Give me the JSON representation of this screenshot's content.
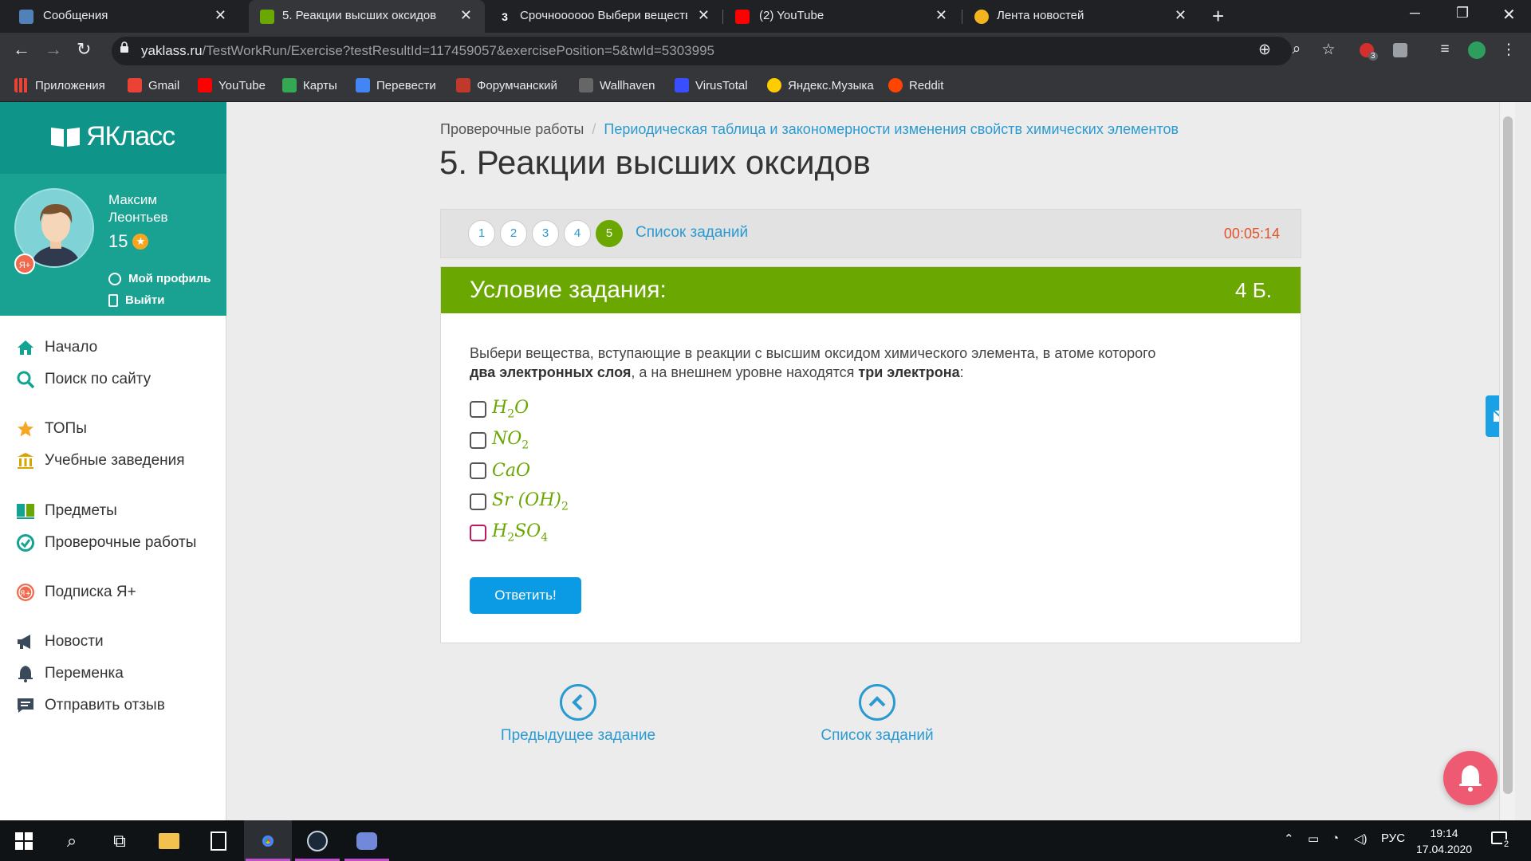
{
  "browser": {
    "tabs": [
      {
        "title": "Сообщения",
        "color": "#5181b8"
      },
      {
        "title": "5. Реакции высших оксидов",
        "color": "#6aa700"
      },
      {
        "title": "Срочноооооо Выбери вещества",
        "color": "#202124"
      },
      {
        "title": "(2) YouTube",
        "color": "#ff0000"
      },
      {
        "title": "Лента новостей",
        "color": "#f2b51d"
      }
    ],
    "url_domain": "yaklass.ru",
    "url_path": "/TestWorkRun/Exercise?testResultId=117459057&exercisePosition=5&twId=5303995",
    "extension_badge": "3",
    "bookmarks": [
      "Приложения",
      "Gmail",
      "YouTube",
      "Карты",
      "Перевести",
      "Форумчанский",
      "Wallhaven",
      "VirusTotal",
      "Яндекс.Музыка",
      "Reddit"
    ]
  },
  "sidebar": {
    "logo": "ЯКласс",
    "user": {
      "first_name": "Максим",
      "last_name": "Леонтьев",
      "points": "15"
    },
    "profile_link": "Мой профиль",
    "logout_link": "Выйти",
    "menu": [
      {
        "label": "Начало",
        "icon": "home-icon"
      },
      {
        "label": "Поиск по сайту",
        "icon": "search-icon"
      },
      {
        "label": "ТОПы",
        "icon": "star-icon"
      },
      {
        "label": "Учебные заведения",
        "icon": "school-icon"
      },
      {
        "label": "Предметы",
        "icon": "book-icon"
      },
      {
        "label": "Проверочные работы",
        "icon": "check-circle-icon"
      },
      {
        "label": "Подписка Я+",
        "icon": "ya-plus-icon"
      },
      {
        "label": "Новости",
        "icon": "megaphone-icon"
      },
      {
        "label": "Переменка",
        "icon": "bell-icon"
      },
      {
        "label": "Отправить отзыв",
        "icon": "feedback-icon"
      }
    ]
  },
  "main": {
    "breadcrumb": {
      "root": "Проверочные работы",
      "separator": "/",
      "topic": "Периодическая таблица и закономерности изменения свойств химических элементов"
    },
    "title": "5. Реакции высших оксидов",
    "pager": {
      "pages": [
        "1",
        "2",
        "3",
        "4",
        "5"
      ],
      "current": "5",
      "task_list": "Список заданий",
      "timer": "00:05:14"
    },
    "task": {
      "header": "Условие задания:",
      "points": "4 Б.",
      "text_part1": "Выбери вещества, вступающие в реакции с высшим оксидом химического элемента, в атоме которого ",
      "bold1": "два электронных слоя",
      "text_part2": ", а на внешнем уровне находятся ",
      "bold2": "три электрона",
      "text_part3": ":",
      "options": [
        {
          "base": "H",
          "sub": "2",
          "rest": "O"
        },
        {
          "base": "NO",
          "sub": "2",
          "rest": ""
        },
        {
          "base": "CaO",
          "sub": "",
          "rest": ""
        },
        {
          "base": "Sr (OH)",
          "sub": "2",
          "rest": ""
        },
        {
          "base": "H",
          "sub": "2",
          "rest": "SO",
          "sub2": "4"
        }
      ],
      "submit": "Ответить!"
    },
    "nav": {
      "prev": "Предыдущее задание",
      "list": "Список заданий"
    }
  },
  "taskbar": {
    "language": "РУС",
    "time": "19:14",
    "date": "17.04.2020",
    "notifications": "2"
  }
}
